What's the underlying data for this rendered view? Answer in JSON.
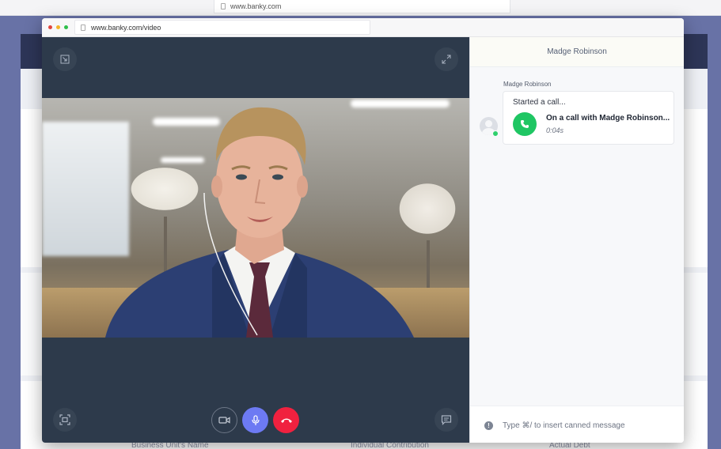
{
  "background": {
    "url": "www.banky.com",
    "footer_labels": [
      "Business Unit's Name",
      "Individual Contribution",
      "Actual Debt"
    ]
  },
  "window": {
    "url": "www.banky.com/video",
    "traffic_light_colors": [
      "#e2463f",
      "#f4b529",
      "#2dbf4a"
    ]
  },
  "video": {
    "minimize_icon": "minimize-icon",
    "fullscreen_icon": "expand-icon",
    "screenshot_icon": "screen-capture-icon",
    "chat_icon": "chat-bubble-icon",
    "controls": [
      {
        "name": "camera-toggle",
        "icon": "camera-icon",
        "color": "#2d3a4b"
      },
      {
        "name": "mic-toggle",
        "icon": "microphone-icon",
        "color": "#6d7af3"
      },
      {
        "name": "end-call",
        "icon": "phone-hangup-icon",
        "color": "#f0213f"
      }
    ]
  },
  "chat": {
    "title": "Madge Robinson",
    "messages": [
      {
        "sender": "Madge Robinson",
        "status_text": "Started a call...",
        "call_title": "On a call with Madge Robinson...",
        "call_duration": "0:04s",
        "call_icon_color": "#1fc663"
      }
    ],
    "composer_placeholder": "Type ⌘/ to insert canned message"
  }
}
